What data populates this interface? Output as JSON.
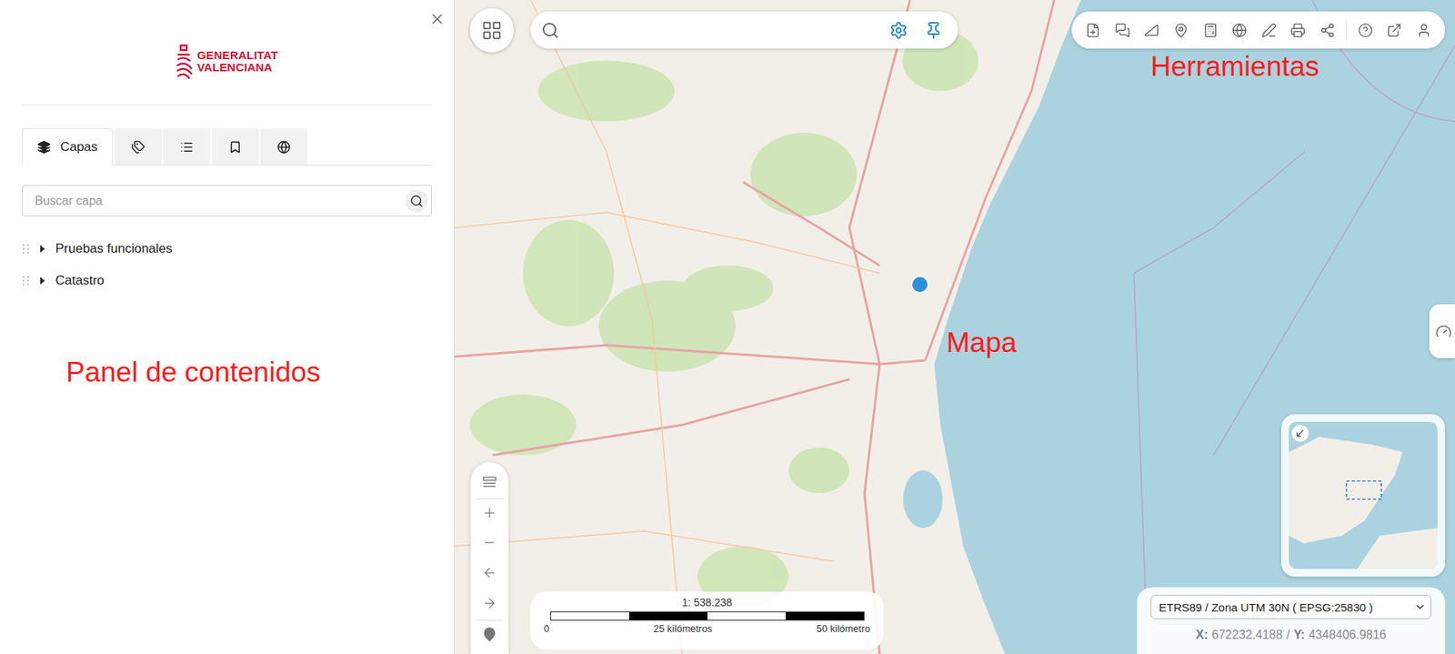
{
  "panel": {
    "logo": {
      "line1": "GENERALITAT",
      "line2": "VALENCIANA"
    }
  },
  "tabs": [
    {
      "label": "Capas",
      "selected": true
    },
    {
      "label": "",
      "selected": false
    },
    {
      "label": "",
      "selected": false
    },
    {
      "label": "",
      "selected": false
    },
    {
      "label": "",
      "selected": false
    }
  ],
  "layerSearch": {
    "placeholder": "Buscar capa"
  },
  "layers": [
    {
      "name": "Pruebas funcionales",
      "expanded": false
    },
    {
      "name": "Catastro",
      "expanded": false
    }
  ],
  "annotations": {
    "panel": "Panel de contenidos",
    "map": "Mapa",
    "tools": "Herramientas"
  },
  "scale": {
    "ratio": "1: 538.238",
    "ticks": [
      "0",
      "25 kilómetros",
      "50 kilómetro"
    ]
  },
  "projection": {
    "value": "ETRS89 / Zona UTM 30N ( EPSG:25830 )"
  },
  "coordinates": {
    "xLabel": "X:",
    "x": "672232.4188",
    "separator": "/",
    "yLabel": "Y:",
    "y": "4348406.9816"
  }
}
